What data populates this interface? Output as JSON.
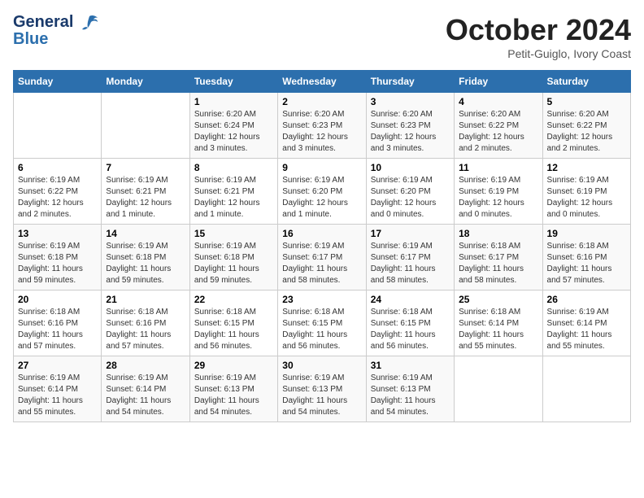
{
  "logo": {
    "line1": "General",
    "line2": "Blue"
  },
  "title": "October 2024",
  "subtitle": "Petit-Guiglo, Ivory Coast",
  "days_of_week": [
    "Sunday",
    "Monday",
    "Tuesday",
    "Wednesday",
    "Thursday",
    "Friday",
    "Saturday"
  ],
  "weeks": [
    [
      {
        "day": "",
        "info": ""
      },
      {
        "day": "",
        "info": ""
      },
      {
        "day": "1",
        "info": "Sunrise: 6:20 AM\nSunset: 6:24 PM\nDaylight: 12 hours and 3 minutes."
      },
      {
        "day": "2",
        "info": "Sunrise: 6:20 AM\nSunset: 6:23 PM\nDaylight: 12 hours and 3 minutes."
      },
      {
        "day": "3",
        "info": "Sunrise: 6:20 AM\nSunset: 6:23 PM\nDaylight: 12 hours and 3 minutes."
      },
      {
        "day": "4",
        "info": "Sunrise: 6:20 AM\nSunset: 6:22 PM\nDaylight: 12 hours and 2 minutes."
      },
      {
        "day": "5",
        "info": "Sunrise: 6:20 AM\nSunset: 6:22 PM\nDaylight: 12 hours and 2 minutes."
      }
    ],
    [
      {
        "day": "6",
        "info": "Sunrise: 6:19 AM\nSunset: 6:22 PM\nDaylight: 12 hours and 2 minutes."
      },
      {
        "day": "7",
        "info": "Sunrise: 6:19 AM\nSunset: 6:21 PM\nDaylight: 12 hours and 1 minute."
      },
      {
        "day": "8",
        "info": "Sunrise: 6:19 AM\nSunset: 6:21 PM\nDaylight: 12 hours and 1 minute."
      },
      {
        "day": "9",
        "info": "Sunrise: 6:19 AM\nSunset: 6:20 PM\nDaylight: 12 hours and 1 minute."
      },
      {
        "day": "10",
        "info": "Sunrise: 6:19 AM\nSunset: 6:20 PM\nDaylight: 12 hours and 0 minutes."
      },
      {
        "day": "11",
        "info": "Sunrise: 6:19 AM\nSunset: 6:19 PM\nDaylight: 12 hours and 0 minutes."
      },
      {
        "day": "12",
        "info": "Sunrise: 6:19 AM\nSunset: 6:19 PM\nDaylight: 12 hours and 0 minutes."
      }
    ],
    [
      {
        "day": "13",
        "info": "Sunrise: 6:19 AM\nSunset: 6:18 PM\nDaylight: 11 hours and 59 minutes."
      },
      {
        "day": "14",
        "info": "Sunrise: 6:19 AM\nSunset: 6:18 PM\nDaylight: 11 hours and 59 minutes."
      },
      {
        "day": "15",
        "info": "Sunrise: 6:19 AM\nSunset: 6:18 PM\nDaylight: 11 hours and 59 minutes."
      },
      {
        "day": "16",
        "info": "Sunrise: 6:19 AM\nSunset: 6:17 PM\nDaylight: 11 hours and 58 minutes."
      },
      {
        "day": "17",
        "info": "Sunrise: 6:19 AM\nSunset: 6:17 PM\nDaylight: 11 hours and 58 minutes."
      },
      {
        "day": "18",
        "info": "Sunrise: 6:18 AM\nSunset: 6:17 PM\nDaylight: 11 hours and 58 minutes."
      },
      {
        "day": "19",
        "info": "Sunrise: 6:18 AM\nSunset: 6:16 PM\nDaylight: 11 hours and 57 minutes."
      }
    ],
    [
      {
        "day": "20",
        "info": "Sunrise: 6:18 AM\nSunset: 6:16 PM\nDaylight: 11 hours and 57 minutes."
      },
      {
        "day": "21",
        "info": "Sunrise: 6:18 AM\nSunset: 6:16 PM\nDaylight: 11 hours and 57 minutes."
      },
      {
        "day": "22",
        "info": "Sunrise: 6:18 AM\nSunset: 6:15 PM\nDaylight: 11 hours and 56 minutes."
      },
      {
        "day": "23",
        "info": "Sunrise: 6:18 AM\nSunset: 6:15 PM\nDaylight: 11 hours and 56 minutes."
      },
      {
        "day": "24",
        "info": "Sunrise: 6:18 AM\nSunset: 6:15 PM\nDaylight: 11 hours and 56 minutes."
      },
      {
        "day": "25",
        "info": "Sunrise: 6:18 AM\nSunset: 6:14 PM\nDaylight: 11 hours and 55 minutes."
      },
      {
        "day": "26",
        "info": "Sunrise: 6:19 AM\nSunset: 6:14 PM\nDaylight: 11 hours and 55 minutes."
      }
    ],
    [
      {
        "day": "27",
        "info": "Sunrise: 6:19 AM\nSunset: 6:14 PM\nDaylight: 11 hours and 55 minutes."
      },
      {
        "day": "28",
        "info": "Sunrise: 6:19 AM\nSunset: 6:14 PM\nDaylight: 11 hours and 54 minutes."
      },
      {
        "day": "29",
        "info": "Sunrise: 6:19 AM\nSunset: 6:13 PM\nDaylight: 11 hours and 54 minutes."
      },
      {
        "day": "30",
        "info": "Sunrise: 6:19 AM\nSunset: 6:13 PM\nDaylight: 11 hours and 54 minutes."
      },
      {
        "day": "31",
        "info": "Sunrise: 6:19 AM\nSunset: 6:13 PM\nDaylight: 11 hours and 54 minutes."
      },
      {
        "day": "",
        "info": ""
      },
      {
        "day": "",
        "info": ""
      }
    ]
  ]
}
